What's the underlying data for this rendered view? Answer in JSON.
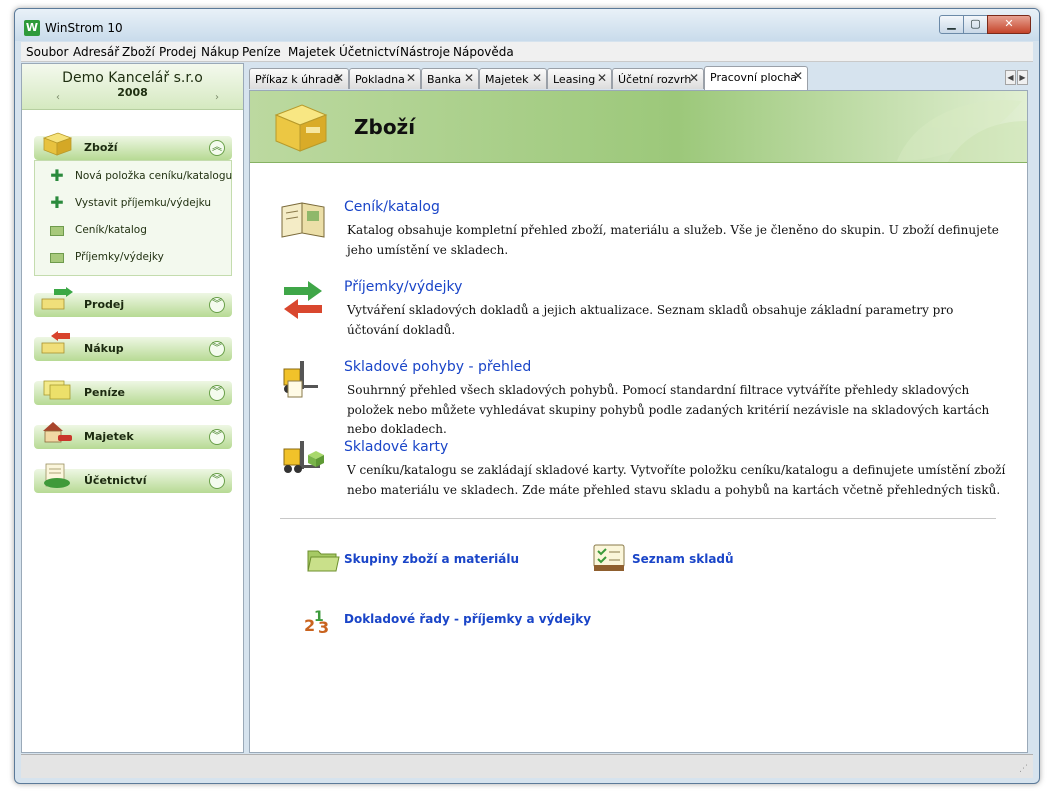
{
  "window": {
    "title": "WinStrom 10",
    "icon_letter": "W",
    "controls": [
      "min",
      "max",
      "close"
    ]
  },
  "menu": [
    "Soubor",
    "Adresář",
    "Zboží",
    "Prodej",
    "Nákup",
    "Peníze",
    "Majetek",
    "Účetnictví",
    "Nástroje",
    "Nápověda"
  ],
  "company": {
    "name": "Demo Kancelář s.r.o",
    "year": "2008"
  },
  "sidebar": {
    "sections": [
      {
        "label": "Zboží",
        "expanded": true,
        "icon": "goods-box-icon"
      },
      {
        "label": "Prodej",
        "expanded": false,
        "icon": "sales-icon"
      },
      {
        "label": "Nákup",
        "expanded": false,
        "icon": "purchase-icon"
      },
      {
        "label": "Peníze",
        "expanded": false,
        "icon": "money-icon"
      },
      {
        "label": "Majetek",
        "expanded": false,
        "icon": "property-icon"
      },
      {
        "label": "Účetnictví",
        "expanded": false,
        "icon": "accounting-icon"
      }
    ],
    "zbozi_items": [
      {
        "label": "Nová položka ceníku/katalogu",
        "icon": "plus-icon"
      },
      {
        "label": "Vystavit příjemku/výdejku",
        "icon": "plus-icon"
      },
      {
        "label": "Ceník/katalog",
        "icon": "folder-icon"
      },
      {
        "label": "Příjemky/výdejky",
        "icon": "folder-icon"
      }
    ]
  },
  "tabs": [
    {
      "label": "Příkaz k úhradě",
      "active": false
    },
    {
      "label": "Pokladna",
      "active": false
    },
    {
      "label": "Banka",
      "active": false
    },
    {
      "label": "Majetek",
      "active": false
    },
    {
      "label": "Leasing",
      "active": false
    },
    {
      "label": "Účetní rozvrh",
      "active": false
    },
    {
      "label": "Pracovní plocha",
      "active": true
    }
  ],
  "tab_close_glyph": "✕",
  "main": {
    "title": "Zboží",
    "entries": [
      {
        "title": "Ceník/katalog",
        "desc": "Katalog obsahuje kompletní přehled zboží, materiálu a služeb. Vše je členěno do skupin. U zboží definujete jeho umístění ve skladech.",
        "icon": "catalog-book-icon"
      },
      {
        "title": "Příjemky/výdejky",
        "desc": "Vytváření skladových dokladů a jejich aktualizace. Seznam skladů obsahuje základní parametry pro účtování dokladů.",
        "icon": "arrows-in-out-icon"
      },
      {
        "title": "Skladové pohyby - přehled",
        "desc": "Souhrnný přehled všech skladových pohybů. Pomocí standardní filtrace vytváříte přehledy skladových položek nebo můžete vyhledávat skupiny pohybů podle zadaných kritérií nezávisle na skladových kartách nebo dokladech.",
        "icon": "forklift-report-icon"
      },
      {
        "title": "Skladové karty",
        "desc": "V ceníku/katalogu se zakládají skladové karty. Vytvoříte položku ceníku/katalogu a definujete umístění zboží nebo materiálu ve skladech. Zde máte přehled stavu skladu a pohybů na kartách včetně přehledných tisků.",
        "icon": "forklift-icon"
      }
    ],
    "links": [
      {
        "label": "Skupiny zboží a materiálu",
        "icon": "folder-icon"
      },
      {
        "label": "Seznam skladů",
        "icon": "warehouse-list-icon"
      },
      {
        "label": "Dokladové řady - příjemky a výdejky",
        "icon": "numbered-series-icon"
      }
    ]
  },
  "colors": {
    "link": "#1a45c8",
    "accent_green": "#9cc87a",
    "title_text": "#101010"
  }
}
